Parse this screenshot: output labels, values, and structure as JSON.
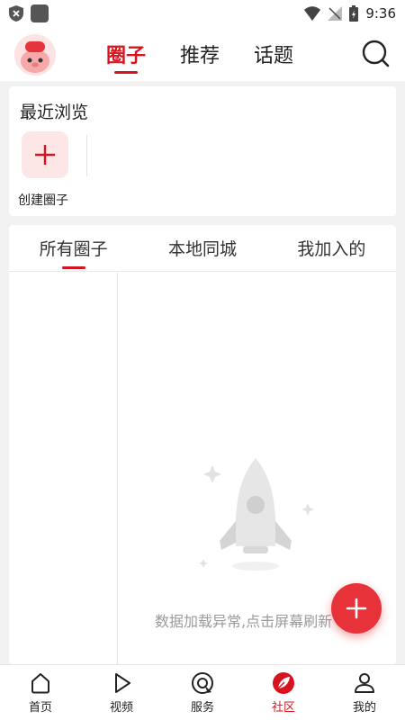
{
  "status_bar": {
    "time": "9:36"
  },
  "top_nav": {
    "tabs": [
      {
        "label": "圈子",
        "active": true
      },
      {
        "label": "推荐",
        "active": false
      },
      {
        "label": "话题",
        "active": false
      }
    ]
  },
  "recent": {
    "title": "最近浏览",
    "create_label": "创建圈子"
  },
  "circles": {
    "tabs": [
      {
        "label": "所有圈子",
        "active": true
      },
      {
        "label": "本地同城",
        "active": false
      },
      {
        "label": "我加入的",
        "active": false
      }
    ],
    "error_text": "数据加载异常,点击屏幕刷新"
  },
  "bottom_nav": {
    "items": [
      {
        "label": "首页",
        "icon": "home-icon",
        "active": false
      },
      {
        "label": "视频",
        "icon": "play-icon",
        "active": false
      },
      {
        "label": "服务",
        "icon": "service-icon",
        "active": false
      },
      {
        "label": "社区",
        "icon": "community-icon",
        "active": true
      },
      {
        "label": "我的",
        "icon": "profile-icon",
        "active": false
      }
    ]
  },
  "colors": {
    "accent": "#d7141e",
    "fab": "#e8323a"
  }
}
